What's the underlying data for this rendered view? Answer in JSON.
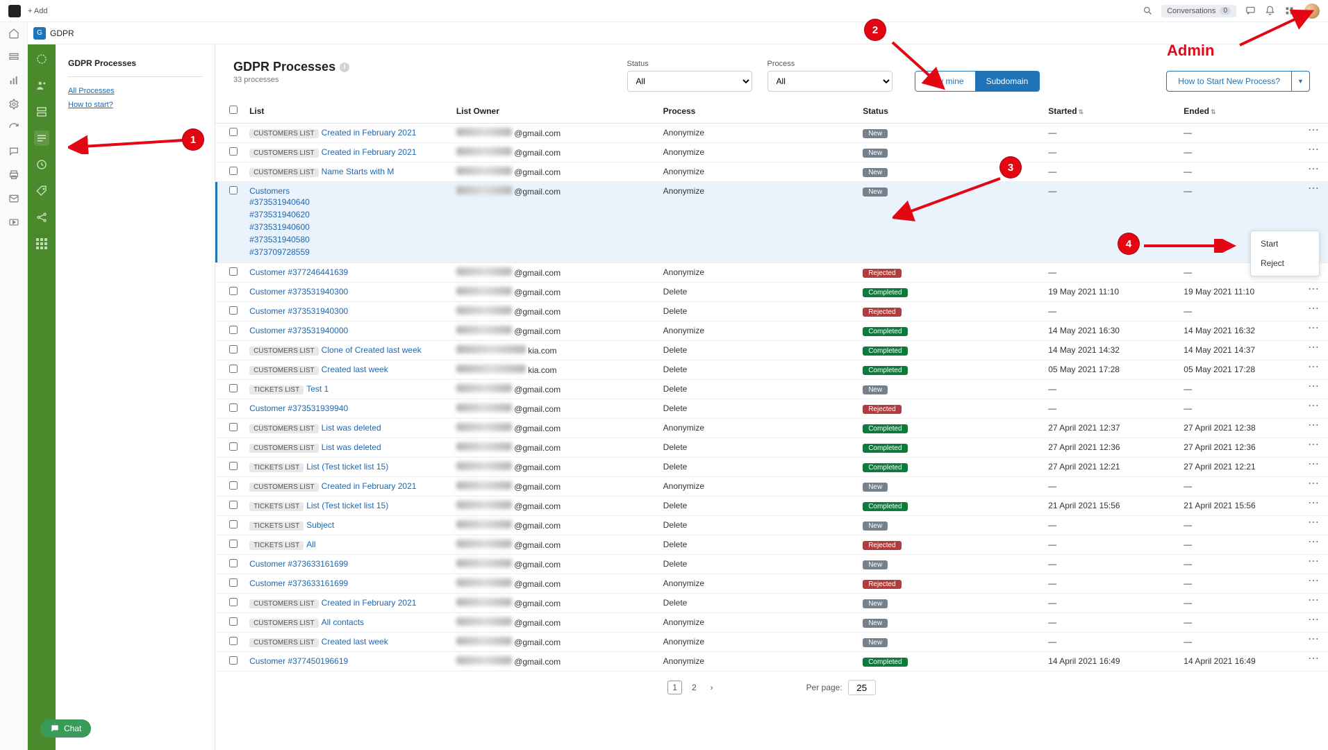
{
  "topbar": {
    "add_label": "+ Add",
    "conversations_label": "Conversations",
    "conversations_count": "0"
  },
  "tab": {
    "chip": "G",
    "name": "GDPR"
  },
  "sidebar": {
    "heading": "GDPR Processes",
    "links": [
      "All Processes",
      "How to start?"
    ]
  },
  "main": {
    "title": "GDPR Processes",
    "subtitle": "33 processes",
    "filter_status_label": "Status",
    "filter_status_value": "All",
    "filter_process_label": "Process",
    "filter_process_value": "All",
    "seg_only_mine": "Only mine",
    "seg_subdomain": "Subdomain",
    "how_button": "How to Start New Process?"
  },
  "columns": {
    "list": "List",
    "owner": "List Owner",
    "process": "Process",
    "status": "Status",
    "started": "Started",
    "ended": "Ended"
  },
  "statuses": {
    "new": "New",
    "rejected": "Rejected",
    "completed": "Completed"
  },
  "em": "—",
  "rows": [
    {
      "tag": "CUSTOMERS LIST",
      "name": "Created in February 2021",
      "owner": "@gmail.com",
      "bw": 80,
      "proc": "Anonymize",
      "status": "new",
      "start": "—",
      "end": "—"
    },
    {
      "tag": "CUSTOMERS LIST",
      "name": "Created in February 2021",
      "owner": "@gmail.com",
      "bw": 80,
      "proc": "Anonymize",
      "status": "new",
      "start": "—",
      "end": "—"
    },
    {
      "tag": "CUSTOMERS LIST",
      "name": "Name Starts with M",
      "owner": "@gmail.com",
      "bw": 80,
      "proc": "Anonymize",
      "status": "new",
      "start": "—",
      "end": "—"
    },
    {
      "selected": true,
      "tag": "",
      "name": "Customers",
      "owner": "@gmail.com",
      "bw": 80,
      "proc": "Anonymize",
      "status": "new",
      "start": "—",
      "end": "—",
      "sub": [
        "#373531940640",
        "#373531940620",
        "#373531940600",
        "#373531940580",
        "#373709728559"
      ]
    },
    {
      "tag": "",
      "name": "Customer #377246441639",
      "owner": "@gmail.com",
      "bw": 80,
      "proc": "Anonymize",
      "status": "rejected",
      "start": "—",
      "end": "—"
    },
    {
      "tag": "",
      "name": "Customer #373531940300",
      "owner": "@gmail.com",
      "bw": 80,
      "proc": "Delete",
      "status": "completed",
      "start": "19 May 2021 11:10",
      "end": "19 May 2021 11:10"
    },
    {
      "tag": "",
      "name": "Customer #373531940300",
      "owner": "@gmail.com",
      "bw": 80,
      "proc": "Delete",
      "status": "rejected",
      "start": "—",
      "end": "—"
    },
    {
      "tag": "",
      "name": "Customer #373531940000",
      "owner": "@gmail.com",
      "bw": 80,
      "proc": "Anonymize",
      "status": "completed",
      "start": "14 May 2021 16:30",
      "end": "14 May 2021 16:32"
    },
    {
      "tag": "CUSTOMERS LIST",
      "name": "Clone of Created last week",
      "owner": "kia.com",
      "bw": 100,
      "proc": "Delete",
      "status": "completed",
      "start": "14 May 2021 14:32",
      "end": "14 May 2021 14:37"
    },
    {
      "tag": "CUSTOMERS LIST",
      "name": "Created last week",
      "owner": "kia.com",
      "bw": 100,
      "proc": "Delete",
      "status": "completed",
      "start": "05 May 2021 17:28",
      "end": "05 May 2021 17:28"
    },
    {
      "tag": "TICKETS LIST",
      "name": "Test 1",
      "owner": "@gmail.com",
      "bw": 80,
      "proc": "Delete",
      "status": "new",
      "start": "—",
      "end": "—"
    },
    {
      "tag": "",
      "name": "Customer #373531939940",
      "owner": "@gmail.com",
      "bw": 80,
      "proc": "Delete",
      "status": "rejected",
      "start": "—",
      "end": "—"
    },
    {
      "tag": "CUSTOMERS LIST",
      "name": "List was deleted",
      "owner": "@gmail.com",
      "bw": 80,
      "proc": "Anonymize",
      "status": "completed",
      "start": "27 April 2021 12:37",
      "end": "27 April 2021 12:38"
    },
    {
      "tag": "CUSTOMERS LIST",
      "name": "List was deleted",
      "owner": "@gmail.com",
      "bw": 80,
      "proc": "Delete",
      "status": "completed",
      "start": "27 April 2021 12:36",
      "end": "27 April 2021 12:36"
    },
    {
      "tag": "TICKETS LIST",
      "name": "List (Test ticket list 15)",
      "owner": "@gmail.com",
      "bw": 80,
      "proc": "Delete",
      "status": "completed",
      "start": "27 April 2021 12:21",
      "end": "27 April 2021 12:21"
    },
    {
      "tag": "CUSTOMERS LIST",
      "name": "Created in February 2021",
      "owner": "@gmail.com",
      "bw": 80,
      "proc": "Anonymize",
      "status": "new",
      "start": "—",
      "end": "—"
    },
    {
      "tag": "TICKETS LIST",
      "name": "List (Test ticket list 15)",
      "owner": "@gmail.com",
      "bw": 80,
      "proc": "Delete",
      "status": "completed",
      "start": "21 April 2021 15:56",
      "end": "21 April 2021 15:56"
    },
    {
      "tag": "TICKETS LIST",
      "name": "Subject",
      "owner": "@gmail.com",
      "bw": 80,
      "proc": "Delete",
      "status": "new",
      "start": "—",
      "end": "—"
    },
    {
      "tag": "TICKETS LIST",
      "name": "All",
      "owner": "@gmail.com",
      "bw": 80,
      "proc": "Delete",
      "status": "rejected",
      "start": "—",
      "end": "—"
    },
    {
      "tag": "",
      "name": "Customer #373633161699",
      "owner": "@gmail.com",
      "bw": 80,
      "proc": "Delete",
      "status": "new",
      "start": "—",
      "end": "—"
    },
    {
      "tag": "",
      "name": "Customer #373633161699",
      "owner": "@gmail.com",
      "bw": 80,
      "proc": "Anonymize",
      "status": "rejected",
      "start": "—",
      "end": "—"
    },
    {
      "tag": "CUSTOMERS LIST",
      "name": "Created in February 2021",
      "owner": "@gmail.com",
      "bw": 80,
      "proc": "Delete",
      "status": "new",
      "start": "—",
      "end": "—"
    },
    {
      "tag": "CUSTOMERS LIST",
      "name": "All contacts",
      "owner": "@gmail.com",
      "bw": 80,
      "proc": "Anonymize",
      "status": "new",
      "start": "—",
      "end": "—"
    },
    {
      "tag": "CUSTOMERS LIST",
      "name": "Created last week",
      "owner": "@gmail.com",
      "bw": 80,
      "proc": "Anonymize",
      "status": "new",
      "start": "—",
      "end": "—"
    },
    {
      "tag": "",
      "name": "Customer #377450196619",
      "owner": "@gmail.com",
      "bw": 80,
      "proc": "Anonymize",
      "status": "completed",
      "start": "14 April 2021 16:49",
      "end": "14 April 2021 16:49"
    }
  ],
  "context_menu": [
    "Start",
    "Reject"
  ],
  "pagination": {
    "pages": [
      "1",
      "2"
    ],
    "per_page_label": "Per page:",
    "per_page_value": "25"
  },
  "chat_label": "Chat",
  "annotations": {
    "admin_label": "Admin",
    "n1": "1",
    "n2": "2",
    "n3": "3",
    "n4": "4"
  }
}
